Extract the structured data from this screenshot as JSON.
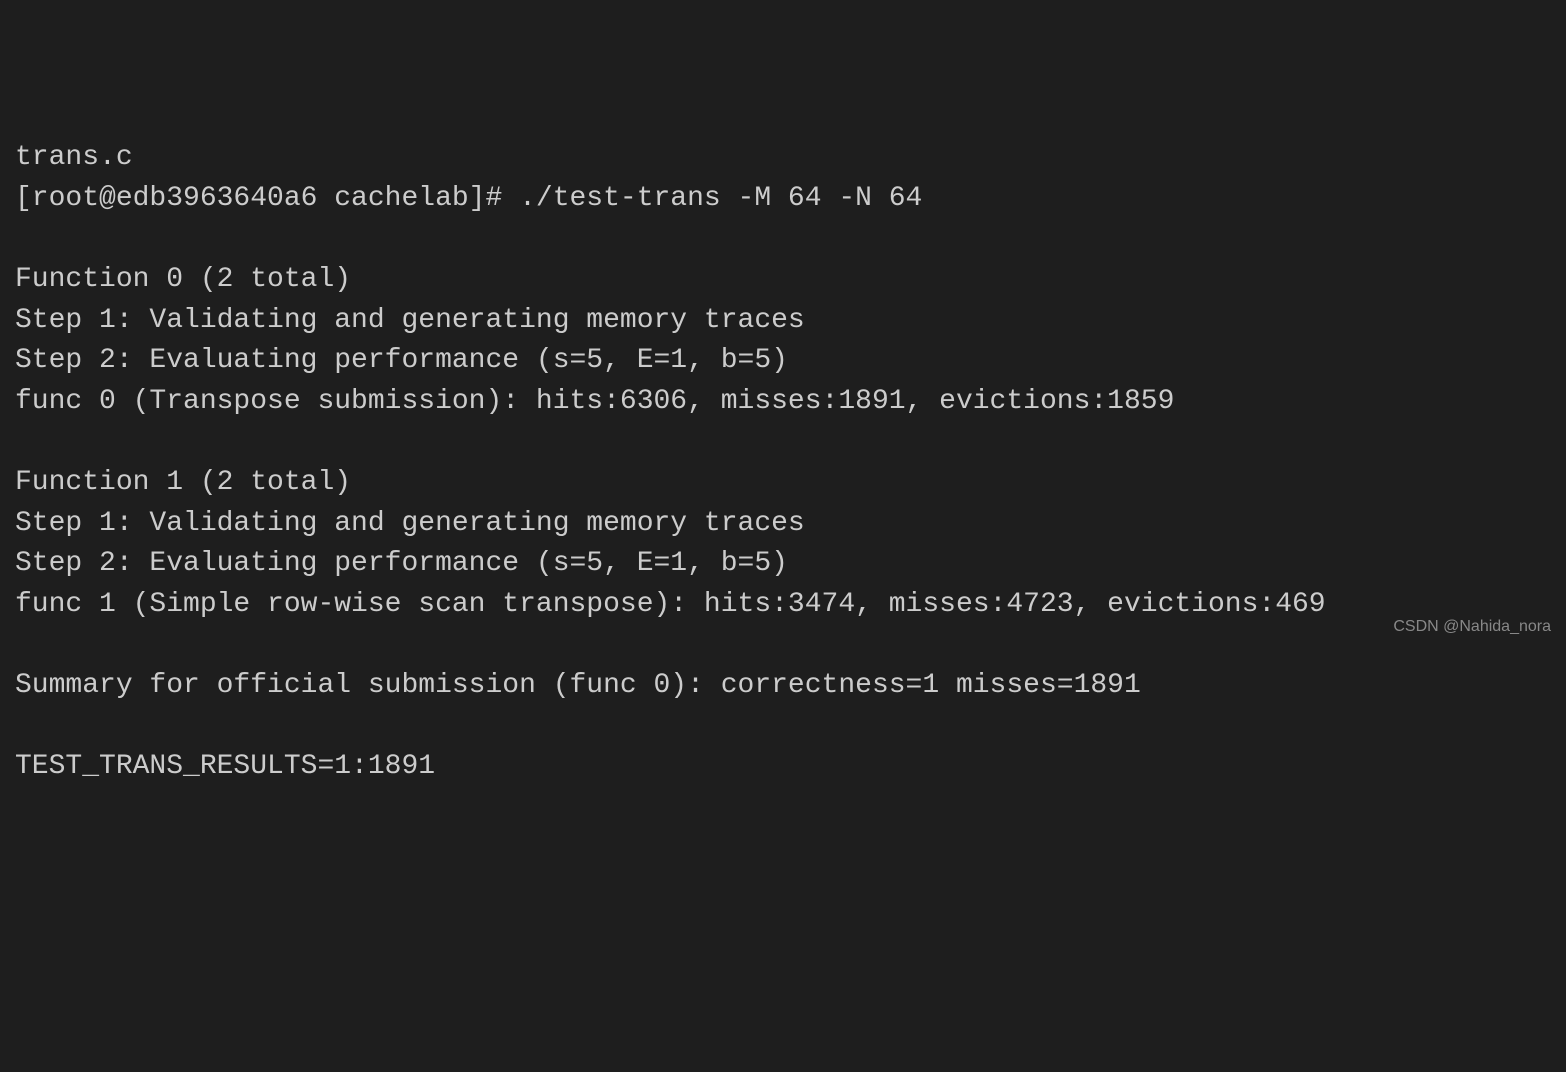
{
  "terminal": {
    "lines": [
      "trans.c",
      "[root@edb3963640a6 cachelab]# ./test-trans -M 64 -N 64",
      "",
      "Function 0 (2 total)",
      "Step 1: Validating and generating memory traces",
      "Step 2: Evaluating performance (s=5, E=1, b=5)",
      "func 0 (Transpose submission): hits:6306, misses:1891, evictions:1859",
      "",
      "Function 1 (2 total)",
      "Step 1: Validating and generating memory traces",
      "Step 2: Evaluating performance (s=5, E=1, b=5)",
      "func 1 (Simple row-wise scan transpose): hits:3474, misses:4723, evictions:469",
      "",
      "Summary for official submission (func 0): correctness=1 misses=1891",
      "",
      "TEST_TRANS_RESULTS=1:1891"
    ]
  },
  "watermark": "CSDN @Nahida_nora"
}
